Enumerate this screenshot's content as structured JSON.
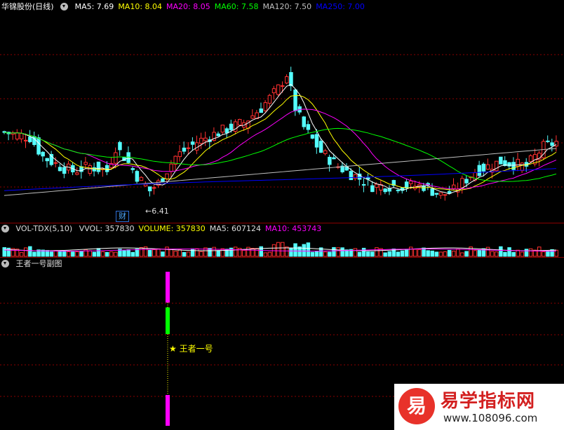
{
  "main": {
    "title": "华锦股份(日线)",
    "ma_labels": [
      {
        "text": "MA5: 7.69",
        "color": "#ffffff"
      },
      {
        "text": "MA10: 8.04",
        "color": "#ffff00"
      },
      {
        "text": "MA20: 8.05",
        "color": "#ff00ff"
      },
      {
        "text": "MA60: 7.58",
        "color": "#00ff00"
      },
      {
        "text": "MA120: 7.50",
        "color": "#c0c0c0"
      },
      {
        "text": "MA250: 7.00",
        "color": "#0000ff"
      }
    ],
    "low_marker": "6.41",
    "cai_badge": "财"
  },
  "volume": {
    "title": "VOL-TDX(5,10)",
    "labels": [
      {
        "text": "VVOL: 357830",
        "color": "#dddddd"
      },
      {
        "text": "VOLUME: 357830",
        "color": "#ffff00"
      },
      {
        "text": "MA5: 607124",
        "color": "#dddddd"
      },
      {
        "text": "MA10: 453743",
        "color": "#ff00ff"
      }
    ]
  },
  "indicator": {
    "title": "王者一号副图",
    "signal_label": "王者一号",
    "star": "★"
  },
  "watermark": {
    "logo_char": "易",
    "title": "易学指标网",
    "url": "www.108096.com"
  },
  "colors": {
    "up": "#ff3030",
    "down": "#54fcfc",
    "ma5": "#ffffff",
    "ma10": "#ffff00",
    "ma20": "#ff00ff",
    "ma60": "#00ff00",
    "ma120": "#c0c0c0",
    "ma250": "#0000ff"
  }
}
